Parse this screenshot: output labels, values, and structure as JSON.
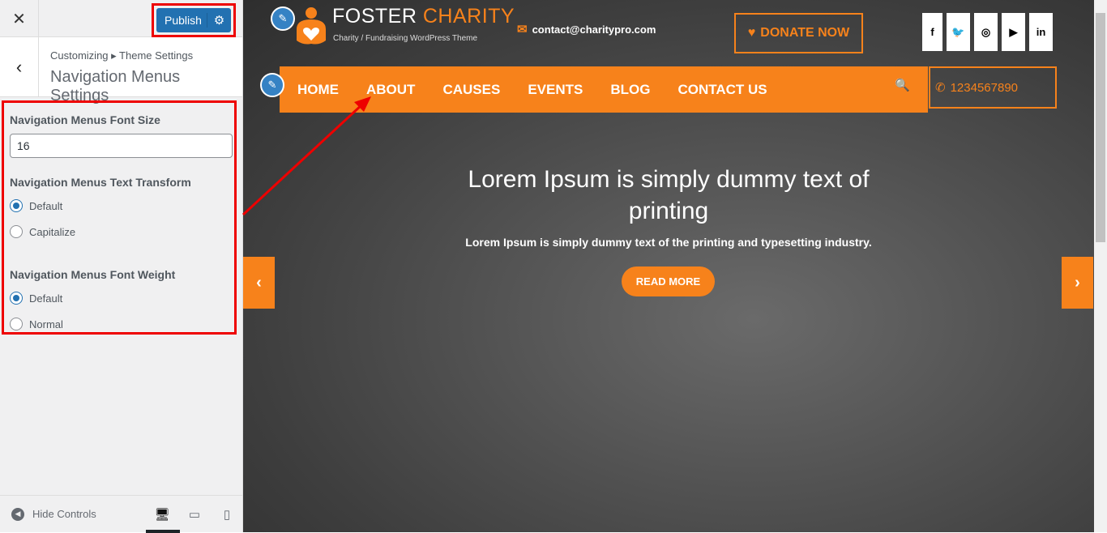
{
  "customizer": {
    "close_icon": "close-icon",
    "publish_label": "Publish",
    "settings_icon": "gear-icon",
    "breadcrumb": [
      "Customizing",
      "Theme Settings"
    ],
    "section_title": "Navigation Menus Settings",
    "font_size_label": "Navigation Menus Font Size",
    "font_size_value": "16",
    "text_transform_label": "Navigation Menus Text Transform",
    "text_transform_options": [
      {
        "label": "Default",
        "checked": true
      },
      {
        "label": "Capitalize",
        "checked": false
      }
    ],
    "font_weight_label": "Navigation Menus Font Weight",
    "font_weight_options": [
      {
        "label": "Default",
        "checked": true
      },
      {
        "label": "Normal",
        "checked": false
      }
    ],
    "hide_controls": "Hide Controls",
    "devices": [
      "desktop",
      "tablet",
      "mobile"
    ],
    "active_device": "desktop"
  },
  "site": {
    "logo_word1": "FOSTER",
    "logo_word2": "CHARITY",
    "tagline": "Charity / Fundraising WordPress Theme",
    "email": "contact@charitypro.com",
    "donate": "DONATE NOW",
    "social": [
      "facebook",
      "twitter",
      "instagram",
      "youtube",
      "linkedin"
    ],
    "nav": [
      "HOME",
      "ABOUT",
      "CAUSES",
      "EVENTS",
      "BLOG",
      "CONTACT US"
    ],
    "phone": "1234567890",
    "hero_title": "Lorem Ipsum is simply dummy text of printing",
    "hero_sub": "Lorem Ipsum is simply dummy text of the printing and typesetting industry.",
    "read_more": "READ MORE",
    "brand_color": "#f7821b",
    "accent_color": "#2271b1",
    "highlight_color": "#e00000"
  }
}
